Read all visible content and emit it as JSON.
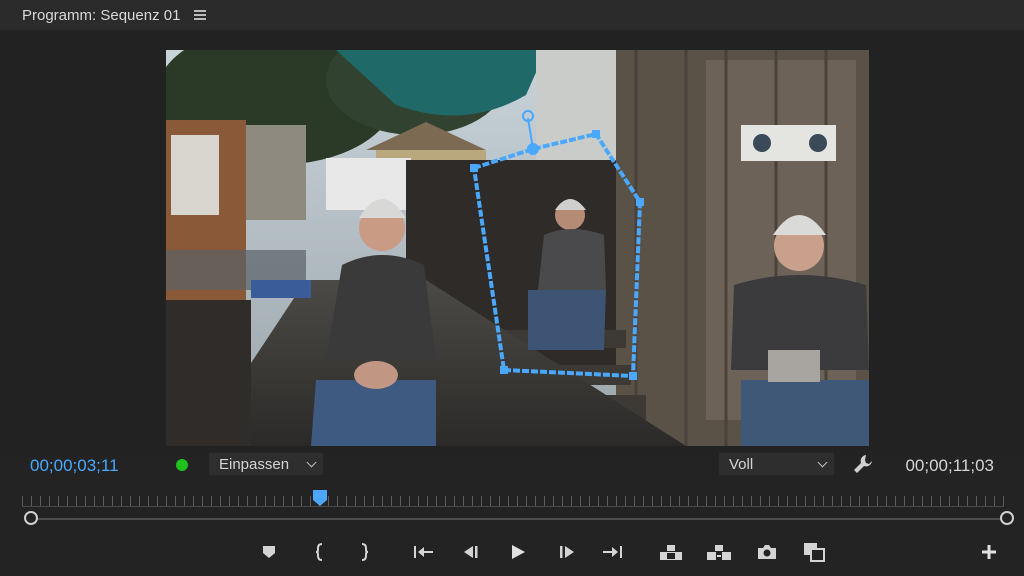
{
  "panel": {
    "title": "Programm: Sequenz 01",
    "menu_icon": "hamburger-icon"
  },
  "monitor": {
    "current_timecode": "00;00;03;11",
    "duration_timecode": "00;00;11;03",
    "zoom_dropdown": "Einpassen",
    "quality_dropdown": "Voll",
    "status_color": "#1fc21f",
    "timecode_color": "#4aa8ff",
    "mask_color": "#4aa8ff",
    "settings_icon": "wrench-icon"
  },
  "transport_buttons": [
    {
      "name": "add-marker",
      "icon": "marker-icon"
    },
    {
      "name": "mark-in",
      "icon": "mark-in-icon"
    },
    {
      "name": "mark-out",
      "icon": "mark-out-icon"
    },
    {
      "name": "go-to-in",
      "icon": "go-to-in-icon"
    },
    {
      "name": "step-back",
      "icon": "step-back-icon"
    },
    {
      "name": "play",
      "icon": "play-icon"
    },
    {
      "name": "step-forward",
      "icon": "step-forward-icon"
    },
    {
      "name": "go-to-out",
      "icon": "go-to-out-icon"
    },
    {
      "name": "lift",
      "icon": "lift-icon"
    },
    {
      "name": "extract",
      "icon": "extract-icon"
    },
    {
      "name": "export-frame",
      "icon": "camera-icon"
    },
    {
      "name": "comparison-view",
      "icon": "compare-icon"
    },
    {
      "name": "button-editor",
      "icon": "plus-icon"
    }
  ]
}
